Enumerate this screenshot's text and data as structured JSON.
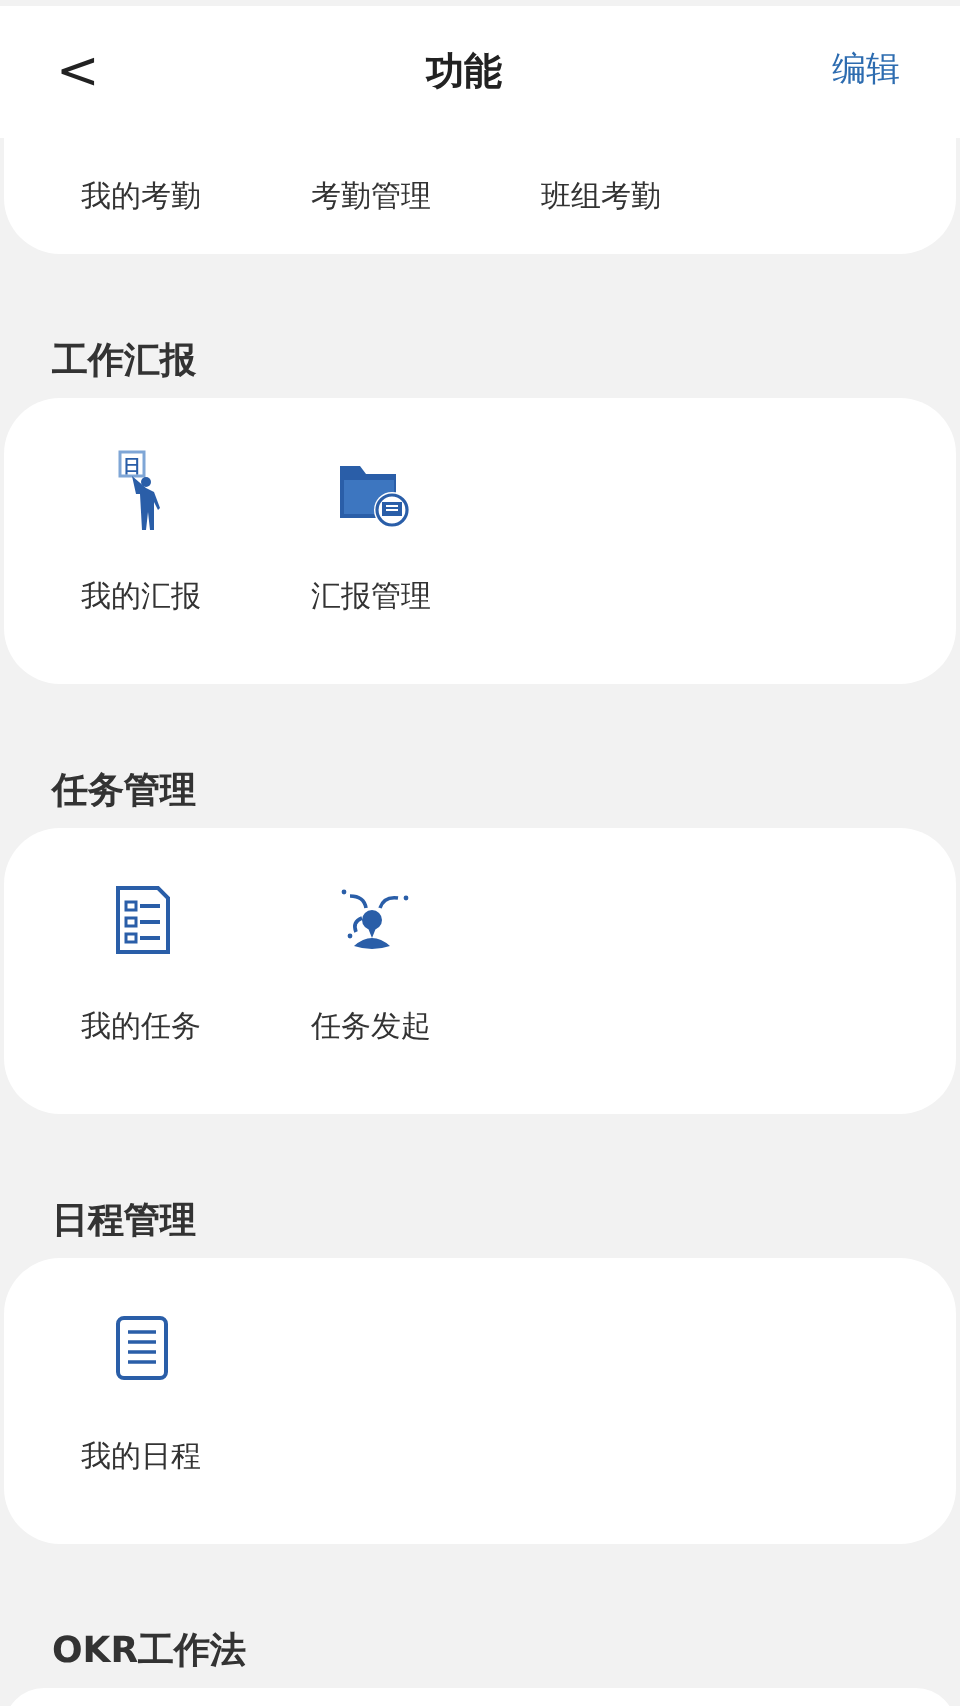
{
  "header": {
    "back": "<",
    "title": "功能",
    "action": "编辑"
  },
  "sections": [
    {
      "items": [
        {
          "label": "我的考勤"
        },
        {
          "label": "考勤管理"
        },
        {
          "label": "班组考勤"
        }
      ]
    },
    {
      "title": "工作汇报",
      "items": [
        {
          "label": "我的汇报",
          "kind": "sign",
          "sign_text": "日"
        },
        {
          "label": "汇报管理",
          "kind": "folder"
        }
      ]
    },
    {
      "title": "任务管理",
      "items": [
        {
          "label": "我的任务",
          "kind": "checklist"
        },
        {
          "label": "任务发起",
          "kind": "person"
        }
      ]
    },
    {
      "title": "日程管理",
      "items": [
        {
          "label": "我的日程",
          "kind": "doc"
        }
      ]
    },
    {
      "title": "OKR工作法"
    }
  ]
}
